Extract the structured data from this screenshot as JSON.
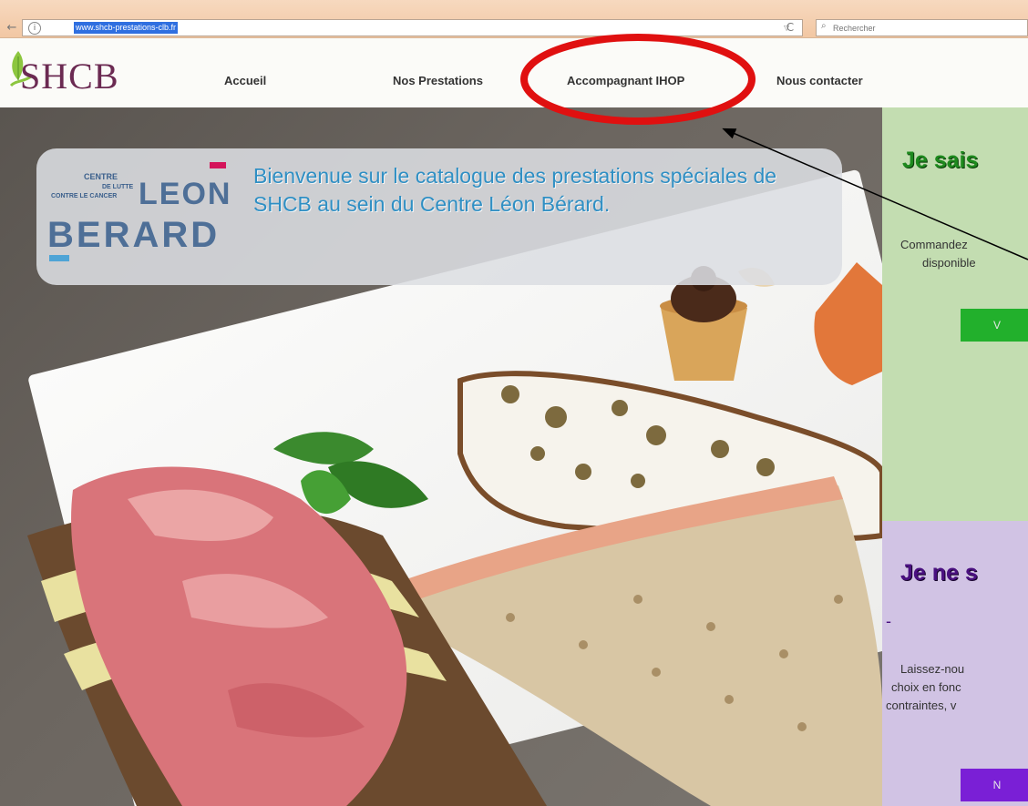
{
  "browser": {
    "url": "www.shcb-prestations-clb.fr",
    "search_placeholder": "Rechercher"
  },
  "site": {
    "logo_text": "SHCB"
  },
  "nav": {
    "items": [
      {
        "label": "Accueil"
      },
      {
        "label": "Nos Prestations"
      },
      {
        "label": "Accompagnant IHOP"
      },
      {
        "label": "Nous contacter"
      }
    ]
  },
  "hero": {
    "partner_logo": {
      "centre": "CENTRE",
      "de_lutte": "DE LUTTE",
      "contre": "CONTRE LE CANCER",
      "leon": "LEON",
      "berard": "BERARD"
    },
    "welcome_text": "Bienvenue sur le catalogue des prestations spéciales de SHCB au sein du Centre Léon Bérard."
  },
  "panels": {
    "green": {
      "title": "Je sais",
      "text_line1": "Commandez",
      "text_line2": "disponible",
      "button_label": "V",
      "color": "#c3ddb1",
      "button_color": "#22b02c"
    },
    "purple": {
      "title": "Je ne s",
      "text_line1": "Laissez-nou",
      "text_line2": "choix en fonc",
      "text_line3": "contraintes, v",
      "button_label": "N",
      "color": "#d1c3e4",
      "button_color": "#7a1fd6"
    }
  },
  "colors": {
    "annotation_ellipse": "#e01010",
    "brand_purple": "#6b2a52",
    "welcome_blue": "#2f8fc4",
    "clb_blue": "#4e6f97",
    "clb_pink": "#d4145a"
  }
}
